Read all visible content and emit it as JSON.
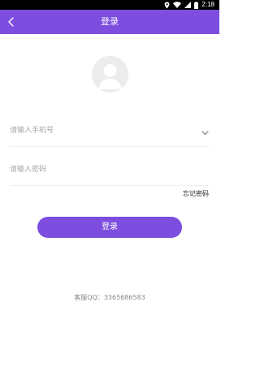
{
  "status_bar": {
    "time": "2:18",
    "icons": [
      "location-icon",
      "wifi-icon",
      "signal-icon",
      "battery-icon"
    ]
  },
  "header": {
    "title": "登录",
    "back_icon": "chevron-left-icon"
  },
  "avatar": {
    "icon": "default-avatar-icon"
  },
  "form": {
    "phone_placeholder": "请输入手机号",
    "phone_value": "",
    "dropdown_icon": "chevron-down-icon",
    "password_placeholder": "请输入密码",
    "password_value": "",
    "forgot_password": "忘记密码",
    "login_button": "登录"
  },
  "footer": {
    "service_qq": "客服QQ：3365686583"
  },
  "colors": {
    "primary": "#7c4dde",
    "status_bar": "#000000",
    "placeholder": "#a6a6a6",
    "footer_text": "#888888"
  }
}
